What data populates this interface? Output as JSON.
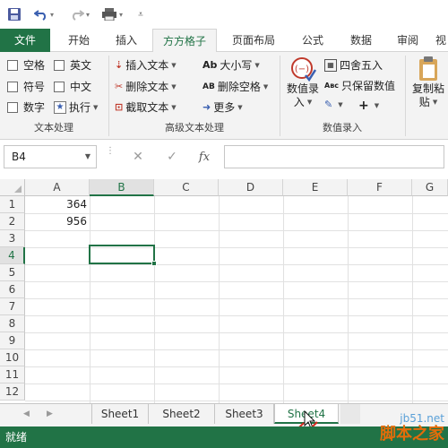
{
  "qat": {
    "save_icon": "save-icon",
    "undo_icon": "undo-icon",
    "redo_icon": "redo-icon",
    "print_icon": "print-icon",
    "customize_icon": "customize-icon"
  },
  "tabs": {
    "file": "文件",
    "home": "开始",
    "insert": "插入",
    "addin": "方方格子",
    "layout": "页面布局",
    "formulas": "公式",
    "data": "数据",
    "review": "审阅",
    "view": "视"
  },
  "ribbon": {
    "text_group": {
      "space": "空格",
      "english": "英文",
      "symbol": "符号",
      "chinese": "中文",
      "digit": "数字",
      "execute": "执行",
      "label": "文本处理"
    },
    "advanced_group": {
      "insert_text": "插入文本",
      "delete_text": "删除文本",
      "extract_text": "截取文本",
      "case": "大小写",
      "delete_space": "删除空格",
      "more": "更多",
      "label": "高级文本处理",
      "case_icon_text": "Ab",
      "delete_space_icon_text": "AB"
    },
    "numeric_group": {
      "value_entry_line1": "数值录",
      "value_entry_line2": "入",
      "round": "四舍五入",
      "keep_value": "只保留数值",
      "keep_value_icon_text": "Aʙc",
      "label": "数值录入"
    },
    "copy_group": {
      "copy_paste_line1": "复制粘",
      "copy_paste_line2": "贴"
    }
  },
  "formula_bar": {
    "name_box": "B4",
    "cancel_icon": "✕",
    "enter_icon": "✓",
    "fx_label": "fx",
    "formula_value": ""
  },
  "grid": {
    "columns": [
      "A",
      "B",
      "C",
      "D",
      "E",
      "F",
      "G"
    ],
    "rows": [
      "1",
      "2",
      "3",
      "4",
      "5",
      "6",
      "7",
      "8",
      "9",
      "10",
      "11",
      "12"
    ],
    "cells": {
      "A1": "364",
      "A2": "956"
    },
    "selected_cell": "B4"
  },
  "sheets": {
    "tabs": [
      "Sheet1",
      "Sheet2",
      "Sheet3",
      "Sheet4"
    ],
    "active": "Sheet4"
  },
  "status": {
    "ready": "就绪"
  },
  "watermark": {
    "url": "jb51.net",
    "name": "脚本之家"
  },
  "colors": {
    "accent": "#217346",
    "ribbon_bg": "#f3f3f3"
  }
}
